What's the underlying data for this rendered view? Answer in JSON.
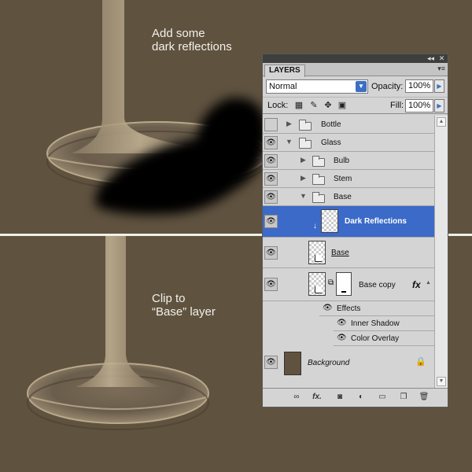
{
  "captions": {
    "top": [
      "Add some",
      "dark reflections"
    ],
    "bottom": [
      "Clip to",
      "“Base” layer"
    ]
  },
  "panel": {
    "window_buttons": [
      "◂◂",
      "✕"
    ],
    "tab_label": "LAYERS",
    "menu_icon": "▾≡",
    "blend_mode": "Normal",
    "opacity_label": "Opacity:",
    "opacity_value": "100%",
    "lock_label": "Lock:",
    "fill_label": "Fill:",
    "fill_value": "100%",
    "selection_color": "#3b6ac8",
    "layers": {
      "bottle": {
        "name": "Bottle",
        "visible": false
      },
      "glass": {
        "name": "Glass",
        "visible": true
      },
      "bulb": {
        "name": "Bulb",
        "visible": true
      },
      "stem": {
        "name": "Stem",
        "visible": true
      },
      "base_group": {
        "name": "Base",
        "visible": true
      },
      "dark_reflections": {
        "name": "Dark Reflections",
        "visible": true,
        "selected": true
      },
      "base_layer": {
        "name": "Base",
        "visible": true
      },
      "base_copy": {
        "name": "Base copy",
        "visible": true,
        "fx": "fx"
      },
      "effects": {
        "name": "Effects"
      },
      "inner_shadow": {
        "name": "Inner Shadow"
      },
      "color_overlay": {
        "name": "Color Overlay"
      },
      "background": {
        "name": "Background",
        "visible": true,
        "color": "#5f523f"
      }
    },
    "footer_icons": [
      "link-icon",
      "fx-icon",
      "mask-icon",
      "adjustment-icon",
      "new-group-icon",
      "new-layer-icon",
      "trash-icon"
    ]
  }
}
